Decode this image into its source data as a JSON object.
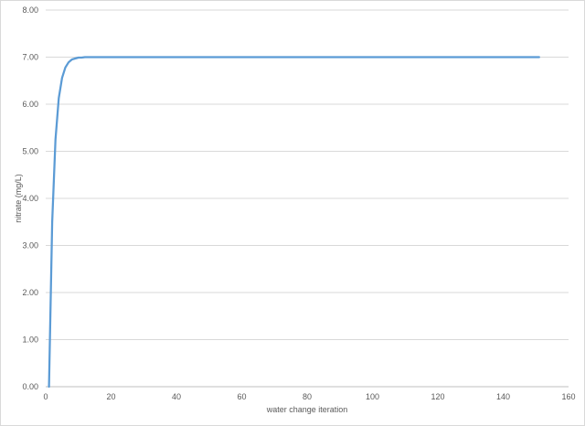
{
  "chart_data": {
    "type": "line",
    "title": "",
    "xlabel": "water change iteration",
    "ylabel": "nitrate (mg/L)",
    "xlim": [
      0,
      160
    ],
    "ylim": [
      0,
      8
    ],
    "x_ticks": [
      0,
      20,
      40,
      60,
      80,
      100,
      120,
      140,
      160
    ],
    "x_tick_labels": [
      "0",
      "20",
      "40",
      "60",
      "80",
      "100",
      "120",
      "140",
      "160"
    ],
    "y_ticks": [
      0,
      1,
      2,
      3,
      4,
      5,
      6,
      7,
      8
    ],
    "y_tick_labels": [
      "0.00",
      "1.00",
      "2.00",
      "3.00",
      "4.00",
      "5.00",
      "6.00",
      "7.00",
      "8.00"
    ],
    "grid": {
      "horizontal": true,
      "vertical": false
    },
    "legend": "none",
    "series": [
      {
        "color": "#5b9bd5",
        "x": [
          1,
          2,
          3,
          4,
          5,
          6,
          7,
          8,
          9,
          10,
          11,
          12,
          13,
          14,
          15,
          20,
          30,
          40,
          50,
          60,
          70,
          80,
          90,
          100,
          110,
          120,
          130,
          140,
          150,
          151
        ],
        "y": [
          0.0,
          3.5,
          5.25,
          6.13,
          6.56,
          6.78,
          6.89,
          6.95,
          6.97,
          6.99,
          6.99,
          7.0,
          7.0,
          7.0,
          7.0,
          7.0,
          7.0,
          7.0,
          7.0,
          7.0,
          7.0,
          7.0,
          7.0,
          7.0,
          7.0,
          7.0,
          7.0,
          7.0,
          7.0,
          7.0
        ]
      }
    ]
  }
}
